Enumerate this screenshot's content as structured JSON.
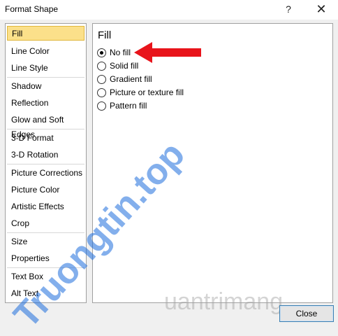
{
  "window": {
    "title": "Format Shape",
    "help_glyph": "?",
    "close_glyph": "✕"
  },
  "sidebar": {
    "items": [
      {
        "label": "Fill",
        "selected": true
      },
      {
        "label": "Line Color"
      },
      {
        "label": "Line Style"
      },
      {
        "label": "Shadow"
      },
      {
        "label": "Reflection"
      },
      {
        "label": "Glow and Soft Edges"
      },
      {
        "label": "3-D Format"
      },
      {
        "label": "3-D Rotation"
      },
      {
        "label": "Picture Corrections"
      },
      {
        "label": "Picture Color"
      },
      {
        "label": "Artistic Effects"
      },
      {
        "label": "Crop"
      },
      {
        "label": "Size"
      },
      {
        "label": "Properties"
      },
      {
        "label": "Text Box"
      },
      {
        "label": "Alt Text"
      }
    ]
  },
  "panel": {
    "title": "Fill",
    "options": [
      {
        "label": "No fill",
        "checked": true
      },
      {
        "label": "Solid fill",
        "checked": false
      },
      {
        "label": "Gradient fill",
        "checked": false
      },
      {
        "label": "Picture or texture fill",
        "checked": false
      },
      {
        "label": "Pattern fill",
        "checked": false
      }
    ]
  },
  "footer": {
    "close_label": "Close"
  },
  "watermarks": {
    "main": "Truongtin.top",
    "secondary": "uantrimang"
  },
  "colors": {
    "selection": "#fbe08a",
    "arrow": "#e8141b",
    "watermark": "#1e6edc"
  }
}
